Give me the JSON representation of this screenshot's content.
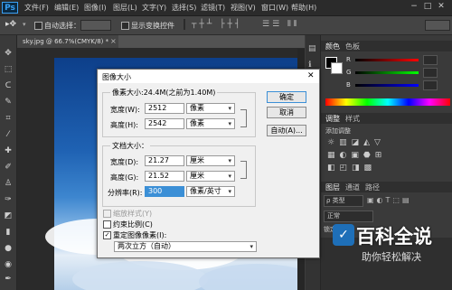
{
  "app": {
    "logo": "Ps"
  },
  "menubar": {
    "items": [
      "文件(F)",
      "编辑(E)",
      "图像(I)",
      "图层(L)",
      "文字(Y)",
      "选择(S)",
      "滤镜(T)",
      "视图(V)",
      "窗口(W)",
      "帮助(H)"
    ],
    "window_buttons": [
      "−",
      "□",
      "✕"
    ]
  },
  "options": {
    "auto_select": "自动选择：",
    "show_transform": "显示变换控件"
  },
  "document_tab": {
    "title": "sky.jpg @ 66.7%(CMYK/8) *",
    "close": "×"
  },
  "panels": {
    "color_tabs": [
      "颜色",
      "色板"
    ],
    "adjust_tabs": [
      "调整",
      "样式"
    ],
    "adjust_add": "添加调整",
    "layer_tabs": [
      "图层",
      "通道",
      "路径"
    ],
    "layer_kind": "ρ 类型",
    "layer_blend": "正常",
    "layer_lock": "锁定："
  },
  "dialog": {
    "title": "图像大小",
    "close": "✕",
    "pixel_dims": "像素大小:24.4M(之前为1.40M)",
    "width_label": "宽度(W):",
    "width_value": "2512",
    "width_unit": "像素",
    "height_label": "高度(H):",
    "height_value": "2542",
    "height_unit": "像素",
    "doc_size": "文档大小：",
    "doc_width_label": "宽度(D):",
    "doc_width_value": "21.27",
    "doc_width_unit": "厘米",
    "doc_height_label": "高度(G):",
    "doc_height_value": "21.52",
    "doc_height_unit": "厘米",
    "resolution_label": "分辨率(R):",
    "resolution_value": "300",
    "resolution_unit": "像素/英寸",
    "scale_styles": "缩放样式(Y)",
    "constrain": "约束比例(C)",
    "resample": "重定图像像素(I):",
    "resample_method": "两次立方（自动）",
    "ok": "确定",
    "cancel": "取消",
    "auto": "自动(A)..."
  },
  "watermark": {
    "line1": "百科全说",
    "line2": "助你轻松解决"
  },
  "colors": {
    "accent": "#3b8fd6",
    "ps_blue": "#3aa0f3",
    "watermark_bg": "#1e6fb8"
  }
}
